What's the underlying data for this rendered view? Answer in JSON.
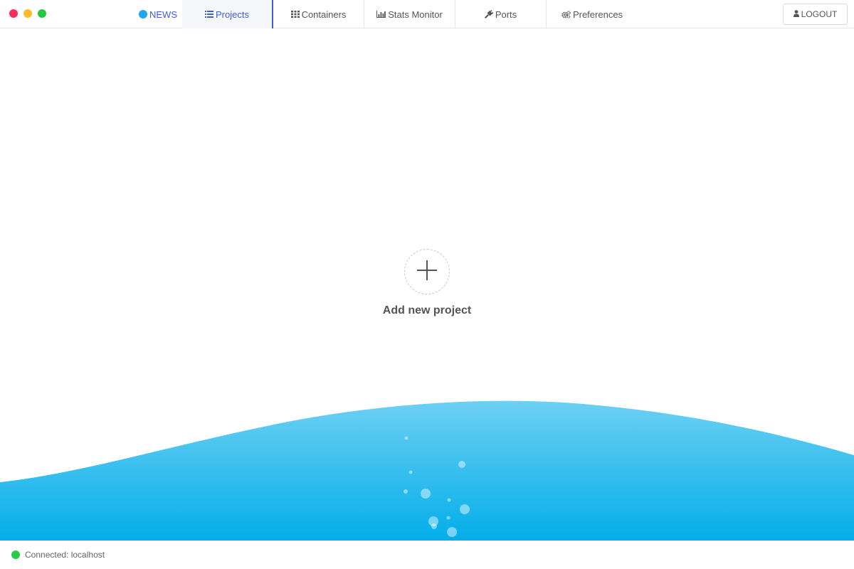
{
  "window_controls": {
    "close_color": "#fd2d58",
    "minimize_color": "#fdbb2b",
    "maximize_color": "#25c93f"
  },
  "news": {
    "label": "NEWS",
    "dot_color": "#1ea7f0"
  },
  "tabs": [
    {
      "label": "Projects",
      "icon": "list-icon",
      "active": true
    },
    {
      "label": "Containers",
      "icon": "grid-icon",
      "active": false
    },
    {
      "label": "Stats Monitor",
      "icon": "bar-chart-icon",
      "active": false
    },
    {
      "label": "Ports",
      "icon": "plug-icon",
      "active": false
    },
    {
      "label": "Preferences",
      "icon": "gears-icon",
      "active": false
    }
  ],
  "logout": {
    "label": "LOGOUT",
    "icon": "user-icon"
  },
  "main": {
    "add_project_label": "Add new project",
    "add_icon": "plus-icon"
  },
  "status": {
    "text": "Connected: localhost",
    "dot_color": "#27cc4a"
  },
  "colors": {
    "accent": "#3d5ce0",
    "wave_top": "#6dd0f2",
    "wave_bottom": "#03aeea"
  }
}
